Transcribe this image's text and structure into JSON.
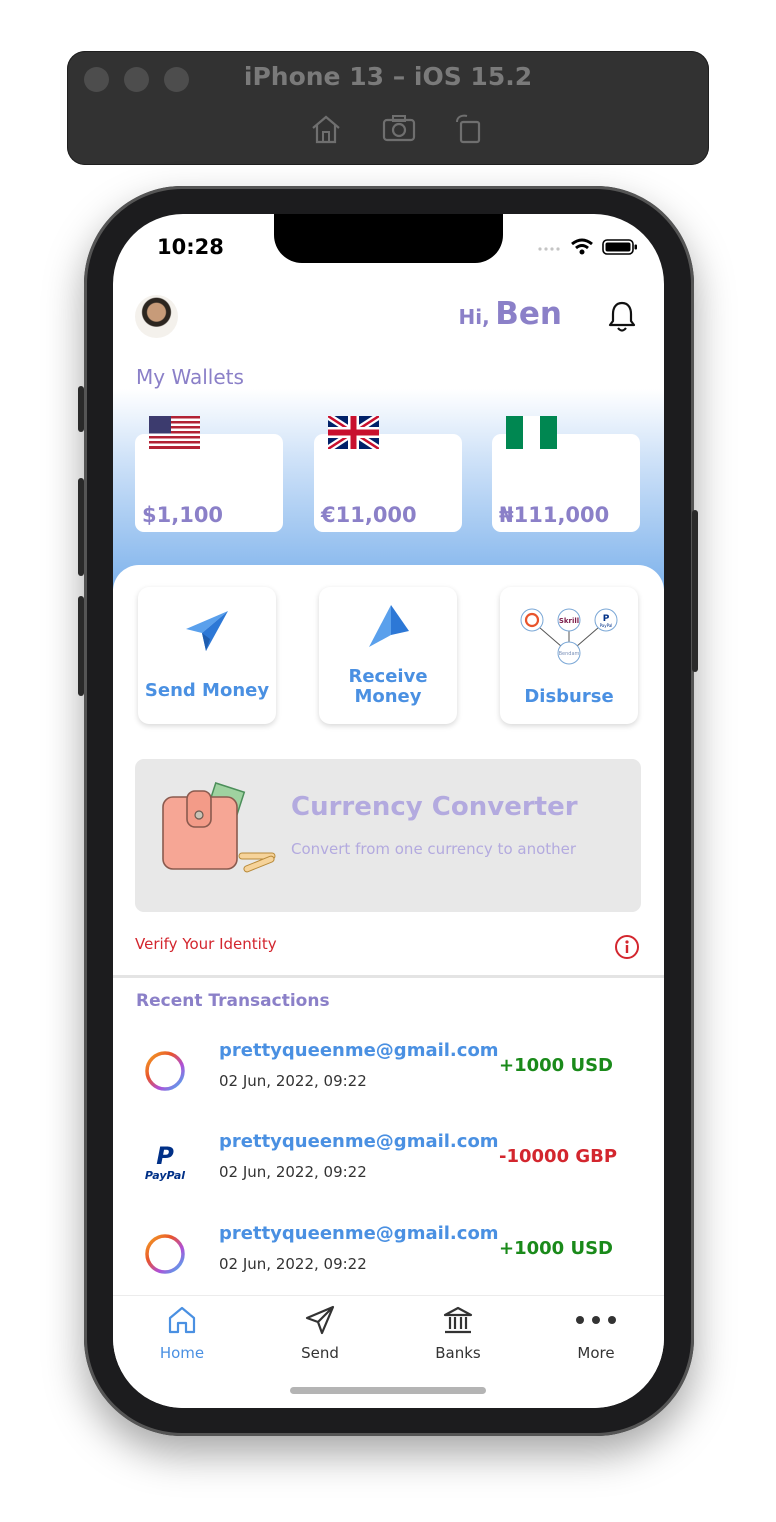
{
  "simulator": {
    "title": "iPhone 13 – iOS 15.2"
  },
  "status_bar": {
    "time": "10:28"
  },
  "header": {
    "greeting": "Hi,",
    "name": "Ben"
  },
  "wallets": {
    "title": "My Wallets",
    "items": [
      {
        "currency": "USD",
        "amount": "$1,100",
        "flag": "us-flag"
      },
      {
        "currency": "GBP",
        "amount": "€11,000",
        "flag": "uk-flag"
      },
      {
        "currency": "NGN",
        "amount": "₦111,000",
        "flag": "ng-flag"
      }
    ]
  },
  "actions": {
    "send": "Send Money",
    "receive_line1": "Receive",
    "receive_line2": "Money",
    "disburse": "Disburse",
    "disburse_nodes": [
      "Skrill",
      "PayPal",
      "Bendam"
    ]
  },
  "converter": {
    "title": "Currency Converter",
    "subtitle": "Convert from one currency to another"
  },
  "verify": {
    "label": "Verify Your Identity"
  },
  "transactions": {
    "title": "Recent Transactions",
    "items": [
      {
        "email": "prettyqueenme@gmail.com",
        "date": "02 Jun, 2022, 09:22",
        "amount": "+1000 USD",
        "icon": "ring-logo",
        "color": "#1a8a1a"
      },
      {
        "email": "prettyqueenme@gmail.com",
        "date": "02 Jun, 2022, 09:22",
        "amount": "-10000 GBP",
        "icon": "paypal-logo",
        "paypal_text": "PayPal",
        "color": "#d3262e"
      },
      {
        "email": "prettyqueenme@gmail.com",
        "date": "02 Jun, 2022, 09:22",
        "amount": "+1000 USD",
        "icon": "ring-logo",
        "color": "#1a8a1a"
      }
    ]
  },
  "tabbar": {
    "home": "Home",
    "send": "Send",
    "banks": "Banks",
    "more": "More",
    "active_color": "#4a90e2"
  },
  "colors": {
    "accent_purple": "#8b80c8",
    "accent_blue": "#4a90e2",
    "positive": "#1a8a1a",
    "negative": "#d3262e"
  }
}
